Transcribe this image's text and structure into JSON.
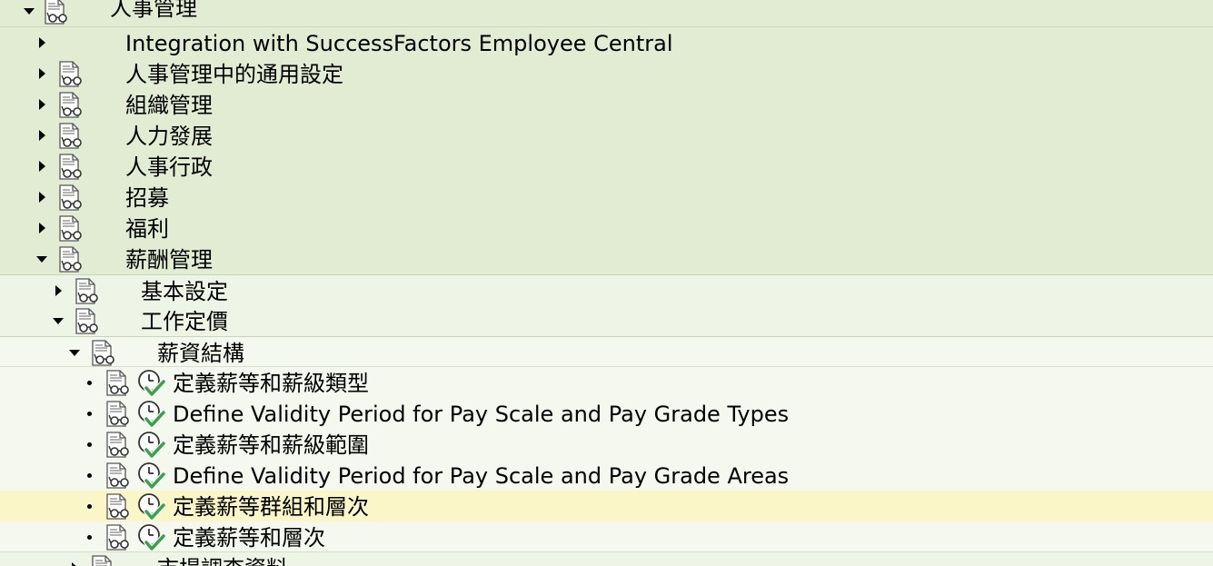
{
  "tree": {
    "root": {
      "label": "人事管理"
    },
    "level1": [
      {
        "label": "Integration with SuccessFactors Employee Central",
        "has_icon": false
      },
      {
        "label": "人事管理中的通用設定",
        "has_icon": true
      },
      {
        "label": "組織管理",
        "has_icon": true
      },
      {
        "label": "人力發展",
        "has_icon": true
      },
      {
        "label": "人事行政",
        "has_icon": true
      },
      {
        "label": "招募",
        "has_icon": true
      },
      {
        "label": "福利",
        "has_icon": true
      },
      {
        "label": "薪酬管理",
        "has_icon": true,
        "expanded": true
      }
    ],
    "level2": [
      {
        "label": "基本設定",
        "expanded": false
      },
      {
        "label": "工作定價",
        "expanded": true
      }
    ],
    "level3": {
      "label": "薪資結構",
      "expanded": true
    },
    "leaves": [
      {
        "label": "定義薪等和薪級類型"
      },
      {
        "label": "Define Validity Period for Pay Scale and Pay Grade Types"
      },
      {
        "label": "定義薪等和薪級範圍"
      },
      {
        "label": "Define Validity Period for Pay Scale and Pay Grade Areas"
      },
      {
        "label": "定義薪等群組和層次",
        "selected": true
      },
      {
        "label": "定義薪等和層次"
      }
    ],
    "partial": {
      "label": "市場調查資料"
    }
  },
  "colors": {
    "level1_bg": "#e2ecd2",
    "level2_bg": "#eef5e6",
    "level3_bg": "#f4f8ee",
    "selected_bg": "#fbf6c8",
    "check_green": "#3aa34a"
  },
  "icons": {
    "document": "document-glasses-icon",
    "activity": "clock-check-icon",
    "expand": "triangle-down-icon",
    "collapse": "triangle-right-icon",
    "leaf": "bullet-icon"
  }
}
